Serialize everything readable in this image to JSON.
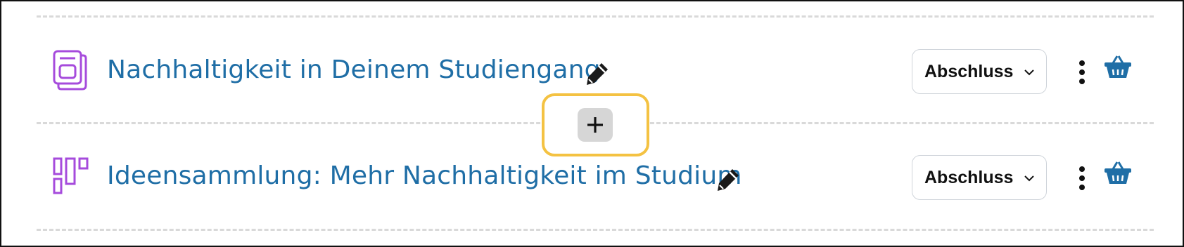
{
  "activities": [
    {
      "title": "Nachhaltigkeit in Deinem Studiengang",
      "icon": "page-icon",
      "completion_label": "Abschluss"
    },
    {
      "title": "Ideensammlung: Mehr Nachhaltigkeit im Studium",
      "icon": "board-icon",
      "completion_label": "Abschluss"
    }
  ],
  "add_button": {
    "label": "+",
    "icon": "plus-icon"
  },
  "colors": {
    "link": "#1f6ea6",
    "activity_icon": "#a64bdc",
    "highlight": "#f4c242",
    "basket": "#1f6ea6"
  }
}
